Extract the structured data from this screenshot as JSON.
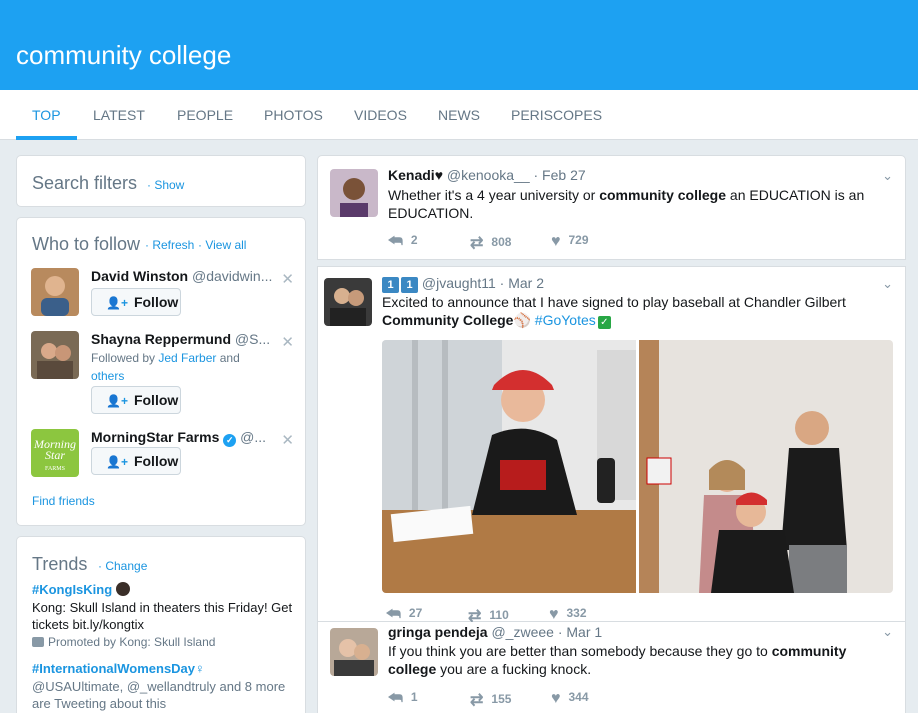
{
  "header": {
    "search_query": "community college"
  },
  "tabs": [
    {
      "label": "TOP"
    },
    {
      "label": "LATEST"
    },
    {
      "label": "PEOPLE"
    },
    {
      "label": "PHOTOS"
    },
    {
      "label": "VIDEOS"
    },
    {
      "label": "NEWS"
    },
    {
      "label": "PERISCOPES"
    }
  ],
  "search_filters": {
    "title": "Search filters",
    "show": "· Show"
  },
  "who_to_follow": {
    "title": "Who to follow",
    "refresh": "· Refresh",
    "view_all": "· View all",
    "follow_label": "Follow",
    "users": [
      {
        "name": "David Winston",
        "handle": "@davidwin...",
        "followed_by": "",
        "followed_name": "",
        "followed_tail": "",
        "followed_others": ""
      },
      {
        "name": "Shayna Reppermund",
        "handle": "@S...",
        "followed_by": "Followed by ",
        "followed_name": "Jed Farber",
        "followed_tail": " and",
        "followed_others": "others"
      },
      {
        "name": "MorningStar Farms",
        "handle": "@...",
        "logo_text": "Morning Star FARMS"
      }
    ],
    "find_friends": "Find friends"
  },
  "trends": {
    "title": "Trends",
    "change": "· Change",
    "items": [
      {
        "tag": "#KongIsKing",
        "desc": "Kong: Skull Island in theaters this Friday! Get tickets bit.ly/kongtix",
        "promoted": "Promoted by Kong: Skull Island"
      },
      {
        "tag": "#InternationalWomensDay",
        "desc": "@USAUltimate, @_wellandtruly and 8 more are Tweeting about this"
      }
    ]
  },
  "tweets": [
    {
      "name": "Kenadi",
      "handle": "@kenooka__",
      "date": "· Feb 27",
      "text_parts": [
        "Whether it's a 4 year university or ",
        "community college",
        " an EDUCATION is an EDUCATION."
      ],
      "replies": "2",
      "retweets": "808",
      "likes": "729"
    },
    {
      "name": "",
      "handle": "@jvaught11",
      "date": "· Mar 2",
      "text_parts": [
        "Excited to announce that I have signed to play baseball at Chandler Gilbert ",
        "Community College",
        " #GoYotes"
      ],
      "replies": "27",
      "retweets": "110",
      "likes": "332"
    },
    {
      "name": "gringa pendeja",
      "handle": "@_zweee",
      "date": "· Mar 1",
      "text_parts": [
        "If you think you are better than somebody because they go to ",
        "community college",
        " you are a fucking knock."
      ],
      "replies": "1",
      "retweets": "155",
      "likes": "344"
    }
  ],
  "colors": {
    "brand": "#1da1f2",
    "link": "#1b95e0",
    "background": "#e6ecf0"
  },
  "icons": {
    "reply": "reply-icon",
    "retweet": "retweet-icon",
    "like": "heart-icon",
    "caret": "chevron-down-icon",
    "close": "close-icon",
    "follow": "add-user-icon",
    "promoted": "promoted-icon"
  }
}
